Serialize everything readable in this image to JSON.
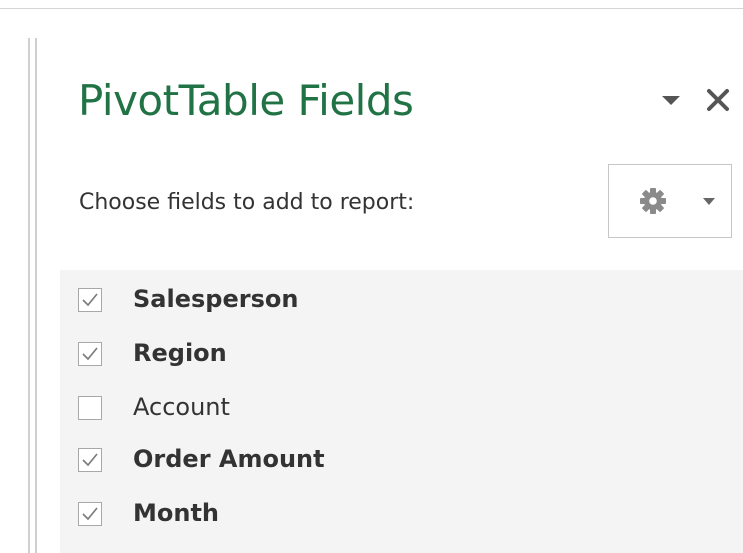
{
  "panel": {
    "title": "PivotTable Fields",
    "choose_label": "Choose fields to add to report:",
    "header_icons": {
      "dropdown": "chevron-down-icon",
      "close": "close-icon",
      "tools": "gear-icon"
    },
    "colors": {
      "title": "#217346",
      "list_background": "#f4f4f4"
    }
  },
  "fields": [
    {
      "label": "Salesperson",
      "checked": true
    },
    {
      "label": "Region",
      "checked": true
    },
    {
      "label": "Account",
      "checked": false
    },
    {
      "label": "Order Amount",
      "checked": true
    },
    {
      "label": "Month",
      "checked": true
    }
  ]
}
